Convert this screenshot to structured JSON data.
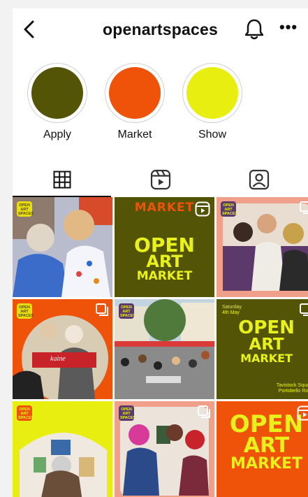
{
  "header": {
    "title": "openartspaces"
  },
  "highlights": [
    {
      "label": "Apply",
      "color": "#545407"
    },
    {
      "label": "Market",
      "color": "#ef5209"
    },
    {
      "label": "Show",
      "color": "#e8ef10"
    }
  ],
  "tabs": [
    {
      "icon": "grid-icon",
      "active": true
    },
    {
      "icon": "reels-icon",
      "active": false
    },
    {
      "icon": "tagged-icon",
      "active": false
    }
  ],
  "posts": {
    "market_top": "MARKET",
    "open_art": [
      "OPEN",
      "ART",
      "MARKET"
    ],
    "mini_logo": [
      "OPEN",
      "ART",
      "SPACES"
    ],
    "date": [
      "Saturday",
      "4th May"
    ],
    "venue": [
      "Tavistock Square",
      "Portobello Road"
    ],
    "crate": "kaine"
  },
  "colors": {
    "olive": "#545407",
    "orange": "#ef5209",
    "yellow": "#e8ef10",
    "text_yellow": "#e8f21a",
    "salmon": "#f0a08a"
  }
}
